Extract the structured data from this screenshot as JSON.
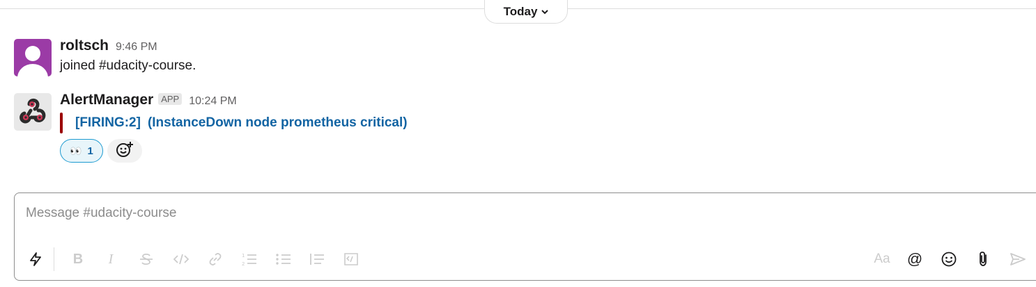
{
  "divider": {
    "label": "Today"
  },
  "messages": [
    {
      "sender": "roltsch",
      "time": "9:46 PM",
      "text": "joined #udacity-course.",
      "avatar": "default-user-avatar"
    },
    {
      "sender": "AlertManager",
      "badge": "APP",
      "time": "10:24 PM",
      "avatar": "webhook-icon",
      "attachment": {
        "bar_color": "#9b0000",
        "link_part1": "[FIRING:2]",
        "link_part2": "(InstanceDown node prometheus critical)"
      },
      "reactions": [
        {
          "emoji": "👀",
          "count": "1"
        }
      ]
    }
  ],
  "composer": {
    "placeholder": "Message #udacity-course",
    "format_label": "Aa",
    "tools": [
      "shortcuts-icon",
      "bold-icon",
      "italic-icon",
      "strikethrough-icon",
      "code-icon",
      "link-icon",
      "ordered-list-icon",
      "bulleted-list-icon",
      "blockquote-icon",
      "code-block-icon",
      "format-toggle-icon",
      "mention-icon",
      "emoji-icon",
      "attach-icon",
      "send-icon"
    ]
  },
  "colors": {
    "link": "#1264a3",
    "avatar_purple": "#9b3ba6",
    "attachment_bar": "#9b0000",
    "reaction_border": "#1d9bd1"
  }
}
